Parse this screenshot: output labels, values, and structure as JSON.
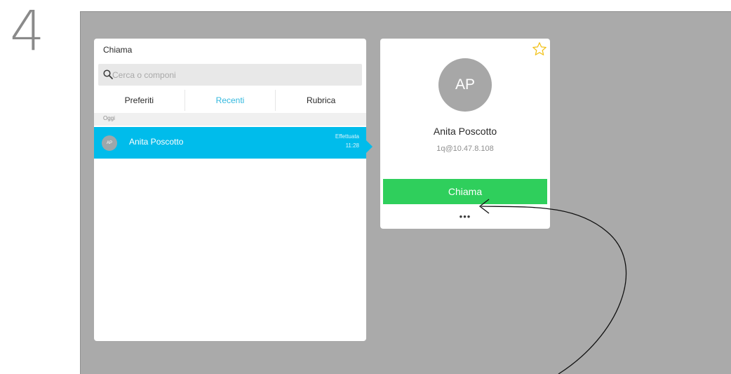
{
  "step": {
    "number": "4"
  },
  "panel": {
    "title": "Chiama",
    "search": {
      "placeholder": "Cerca o componi",
      "value": ""
    },
    "tabs": [
      {
        "label": "Preferiti",
        "active": false
      },
      {
        "label": "Recenti",
        "active": true
      },
      {
        "label": "Rubrica",
        "active": false
      }
    ],
    "section_header": "Oggi",
    "recents": [
      {
        "initials": "AP",
        "name": "Anita Poscotto",
        "status": "Effettuata",
        "time": "11:28"
      }
    ]
  },
  "card": {
    "favorite_icon": "star-outline-icon",
    "initials": "AP",
    "name": "Anita Poscotto",
    "address": "1q@10.47.8.108",
    "call_label": "Chiama",
    "more_label": "•••"
  },
  "colors": {
    "accent": "#00bceb",
    "active_tab": "#32b8de",
    "call_button": "#2fcf5c",
    "star": "#f2c21b",
    "screen_background": "#aaaaaa"
  }
}
